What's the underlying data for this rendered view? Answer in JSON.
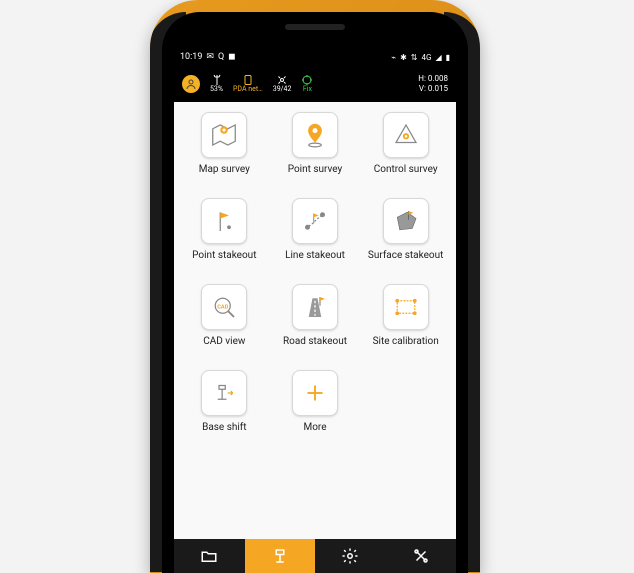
{
  "statusbar": {
    "time": "10:19",
    "left_icons": [
      "✉",
      "Q",
      "◼"
    ],
    "right_icons": [
      "⌁",
      "✱",
      "⇅",
      "4G",
      "◢",
      "▮"
    ]
  },
  "appbar": {
    "battery": "53%",
    "pda": "PDA net…",
    "sats": "39/42",
    "fix": "Fix",
    "h": "H: 0.008",
    "v": "V: 0.015"
  },
  "grid": [
    {
      "id": "map-survey",
      "label": "Map survey"
    },
    {
      "id": "point-survey",
      "label": "Point survey"
    },
    {
      "id": "control-survey",
      "label": "Control survey"
    },
    {
      "id": "point-stakeout",
      "label": "Point stakeout"
    },
    {
      "id": "line-stakeout",
      "label": "Line stakeout"
    },
    {
      "id": "surface-stakeout",
      "label": "Surface stakeout"
    },
    {
      "id": "cad-view",
      "label": "CAD view"
    },
    {
      "id": "road-stakeout",
      "label": "Road stakeout"
    },
    {
      "id": "site-calibration",
      "label": "Site calibration"
    },
    {
      "id": "base-shift",
      "label": "Base shift"
    },
    {
      "id": "more",
      "label": "More"
    }
  ],
  "nav": {
    "items": [
      "folder",
      "survey",
      "settings",
      "tools"
    ],
    "active": 1
  },
  "colors": {
    "accent": "#f5a623",
    "dark": "#1a1a1a"
  }
}
